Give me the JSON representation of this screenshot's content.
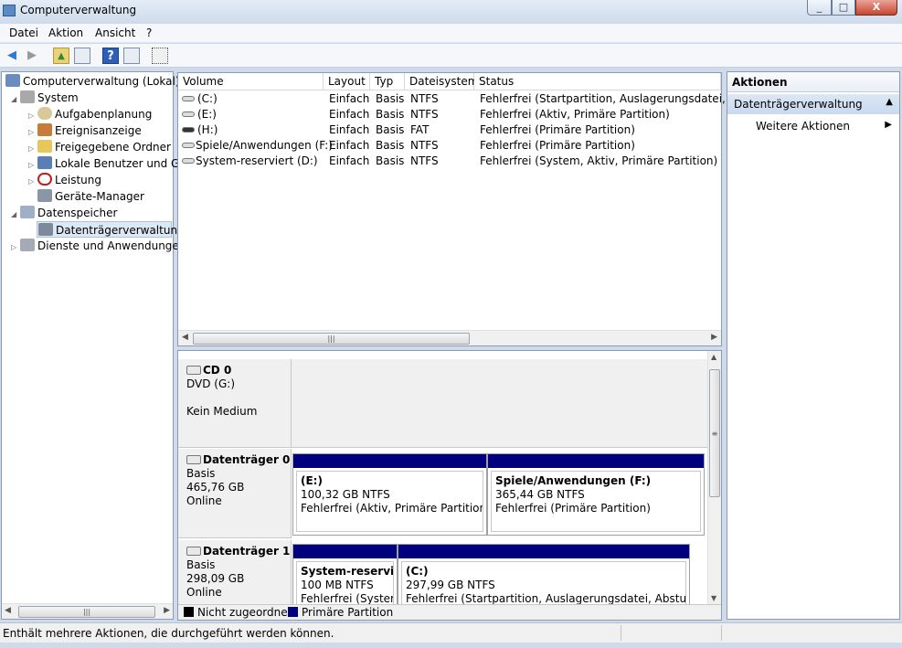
{
  "window": {
    "title": "Computerverwaltung",
    "min": "_",
    "max": "□",
    "close": "X"
  },
  "menu": [
    "Datei",
    "Aktion",
    "Ansicht",
    "?"
  ],
  "toolbar": {
    "back": "◀",
    "forward": "▶",
    "up": "▲",
    "help": "?"
  },
  "tree": [
    {
      "label": "Computerverwaltung (Lokal)",
      "icon": "computer-icon",
      "exp": ""
    },
    {
      "label": "System",
      "icon": "tools-icon",
      "exp": "◢"
    },
    {
      "label": "Aufgabenplanung",
      "icon": "clock-icon",
      "exp": "▷"
    },
    {
      "label": "Ereignisanzeige",
      "icon": "event-viewer-icon",
      "exp": "▷"
    },
    {
      "label": "Freigegebene Ordner",
      "icon": "shared-folder-icon",
      "exp": "▷"
    },
    {
      "label": "Lokale Benutzer und Gru",
      "icon": "users-icon",
      "exp": "▷"
    },
    {
      "label": "Leistung",
      "icon": "performance-icon",
      "exp": "▷"
    },
    {
      "label": "Geräte-Manager",
      "icon": "device-manager-icon",
      "exp": ""
    },
    {
      "label": "Datenspeicher",
      "icon": "storage-icon",
      "exp": "◢"
    },
    {
      "label": "Datenträgerverwaltung",
      "icon": "disk-management-icon",
      "exp": ""
    },
    {
      "label": "Dienste und Anwendungen",
      "icon": "services-icon",
      "exp": "▷"
    }
  ],
  "columns": [
    "Volume",
    "Layout",
    "Typ",
    "Dateisystem",
    "Status"
  ],
  "volumes": [
    {
      "volume": "(C:)",
      "layout": "Einfach",
      "typ": "Basis",
      "fs": "NTFS",
      "status": "Fehlerfrei (Startpartition, Auslagerungsdatei, Abstu"
    },
    {
      "volume": "(E:)",
      "layout": "Einfach",
      "typ": "Basis",
      "fs": "NTFS",
      "status": "Fehlerfrei (Aktiv, Primäre Partition)"
    },
    {
      "volume": "(H:)",
      "layout": "Einfach",
      "typ": "Basis",
      "fs": "FAT",
      "status": "Fehlerfrei (Primäre Partition)"
    },
    {
      "volume": "Spiele/Anwendungen (F:)",
      "layout": "Einfach",
      "typ": "Basis",
      "fs": "NTFS",
      "status": "Fehlerfrei (Primäre Partition)"
    },
    {
      "volume": "System-reserviert (D:)",
      "layout": "Einfach",
      "typ": "Basis",
      "fs": "NTFS",
      "status": "Fehlerfrei (System, Aktiv, Primäre Partition)"
    }
  ],
  "disks": {
    "cd0": {
      "name": "CD 0",
      "line1": "DVD (G:)",
      "line2": "Kein Medium"
    },
    "d0": {
      "name": "Datenträger 0",
      "type": "Basis",
      "size": "465,76 GB",
      "state": "Online",
      "p1": {
        "title": "(E:)",
        "size": "100,32 GB NTFS",
        "status": "Fehlerfrei (Aktiv, Primäre Partition)"
      },
      "p2": {
        "title": "Spiele/Anwendungen  (F:)",
        "size": "365,44 GB NTFS",
        "status": "Fehlerfrei (Primäre Partition)"
      }
    },
    "d1": {
      "name": "Datenträger 1",
      "type": "Basis",
      "size": "298,09 GB",
      "state": "Online",
      "p1": {
        "title": "System-reserviert",
        "size": "100 MB NTFS",
        "status": "Fehlerfrei (System,"
      },
      "p2": {
        "title": "(C:)",
        "size": "297,99 GB NTFS",
        "status": "Fehlerfrei (Startpartition, Auslagerungsdatei, Absturzabbil"
      }
    }
  },
  "legend": {
    "unallocated": "Nicht zugeordnet",
    "primary": "Primäre Partition"
  },
  "actions": {
    "header": "Aktionen",
    "section": "Datenträgerverwaltung",
    "more": "Weitere Aktionen"
  },
  "status": "Enthält mehrere Aktionen, die durchgeführt werden können.",
  "colors": {
    "primary_partition": "#00007f",
    "unallocated": "#000000",
    "selection": "#dde8f5"
  }
}
